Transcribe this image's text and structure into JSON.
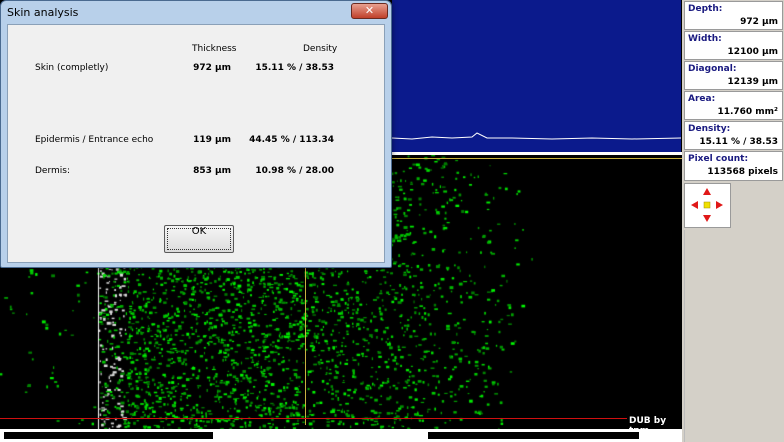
{
  "dialog": {
    "title": "Skin analysis",
    "close_glyph": "✕",
    "headers": {
      "thickness": "Thickness",
      "density": "Density"
    },
    "rows": [
      {
        "label": "Skin (completly)",
        "thickness": "972 µm",
        "density": "15.11 %  /  38.53"
      },
      {
        "label": "Epidermis / Entrance echo",
        "thickness": "119 µm",
        "density": "44.45 %  /  113.34"
      },
      {
        "label": "Dermis:",
        "thickness": "853 µm",
        "density": "10.98 %  /  28.00"
      }
    ],
    "ok_label": "OK"
  },
  "side_panel": {
    "depth": {
      "label": "Depth:",
      "value": "972 µm"
    },
    "width": {
      "label": "Width:",
      "value": "12100 µm"
    },
    "diagonal": {
      "label": "Diagonal:",
      "value": "12139 µm"
    },
    "area": {
      "label": "Area:",
      "value": "11.760 mm²"
    },
    "density": {
      "label": "Density:",
      "value": "15.11 %  /  38.53"
    },
    "pixel_count": {
      "label": "Pixel count:",
      "value": "113568 pixels"
    },
    "navigation_icons": [
      "arrow-up-icon",
      "arrow-left-icon",
      "center-dot-icon",
      "arrow-right-icon",
      "arrow-down-icon"
    ]
  },
  "viewer": {
    "watermark": "DUB by tpm"
  },
  "colors": {
    "profile_background": "#0b1a8c",
    "echo_signal": "#22c02a",
    "marker_red": "#d01010",
    "marker_yellow": "#c8b040",
    "nav_arrow": "#e01818",
    "nav_center": "#f0e000"
  }
}
